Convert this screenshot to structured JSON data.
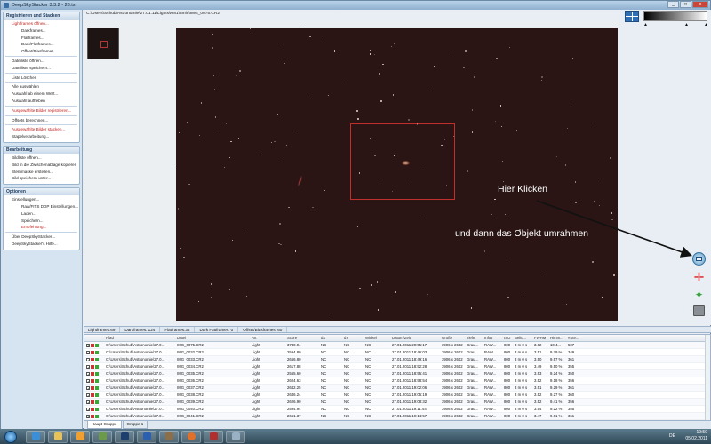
{
  "window": {
    "title": "DeepSkyStacker 3.3.2 - 28.txt",
    "buttons": [
      "_",
      "□",
      "x"
    ]
  },
  "path": "C:\\Users\\Schub\\Astronomie\\27.01.11\\Lights\\M81\\3min\\IMG_0075.CR2",
  "sidebar": {
    "group1": {
      "title": "Registrieren und Stacken",
      "items": [
        {
          "label": "Lightframes öffnen...",
          "red": true,
          "sub": false
        },
        {
          "label": "Darkframes...",
          "red": false,
          "sub": true
        },
        {
          "label": "Flatframes...",
          "red": false,
          "sub": true
        },
        {
          "label": "Dark/Flatframes...",
          "red": false,
          "sub": true
        },
        {
          "label": "Offset/Biasframes...",
          "red": false,
          "sub": true
        },
        {
          "label": "Dateiliste öffnen...",
          "red": false,
          "sub": false
        },
        {
          "label": "Dateiliste speichern...",
          "red": false,
          "sub": false
        },
        {
          "label": "Liste Löschen",
          "red": false,
          "sub": false
        },
        {
          "label": "Alle auswählen",
          "red": false,
          "sub": false
        },
        {
          "label": "Auswahl ab einem Wert...",
          "red": false,
          "sub": false
        },
        {
          "label": "Auswahl aufheben",
          "red": false,
          "sub": false
        },
        {
          "label": "Ausgewählte Bilder registrieren...",
          "red": true,
          "sub": false
        },
        {
          "label": "Offsets berechnen...",
          "red": false,
          "sub": false
        },
        {
          "label": "Ausgewählte Bilder stacken...",
          "red": true,
          "sub": false
        },
        {
          "label": "Stapelverarbeitung...",
          "red": false,
          "sub": false
        }
      ]
    },
    "group2": {
      "title": "Bearbeitung",
      "items": [
        "Bildliste öffnen...",
        "Bild in die Zwischenablage kopieren",
        "Sternmaske erstellen...",
        "Bild speichern unter..."
      ]
    },
    "group3": {
      "title": "Optionen",
      "items": [
        {
          "label": "Einstellungen...",
          "red": false,
          "sub": false
        },
        {
          "label": "Raw/FITS DDP Einstellungen...",
          "red": false,
          "sub": true
        },
        {
          "label": "Laden...",
          "red": false,
          "sub": true
        },
        {
          "label": "Speichern...",
          "red": false,
          "sub": true
        },
        {
          "label": "Empfehlung...",
          "red": true,
          "sub": true
        },
        {
          "label": "Über DeepSkyStacker...",
          "red": false,
          "sub": false
        },
        {
          "label": "DeepSkyStacker's Hilfe...",
          "red": false,
          "sub": false
        }
      ]
    }
  },
  "annotation": {
    "click_here": "Hier Klicken",
    "frame_object": "und dann das Objekt umrahmen"
  },
  "counts": [
    "Lightframes:69",
    "Darkframes: 124",
    "Flatframes:36",
    "Dark Flatframes: 0",
    "Offset/Biasframes: 60"
  ],
  "table": {
    "headers": [
      "",
      "Pfad",
      "Datei",
      "Art",
      "Score",
      "dX",
      "dY",
      "Winkel",
      "Datum/Zeit",
      "Größe",
      "Tiefe",
      "Infos",
      "ISO",
      "Belic...",
      "FWHM",
      "Himm...",
      "#Ste..."
    ],
    "rows": [
      [
        "C:\\Users\\Schub\\Astronomie\\27.0...",
        "IMG_0075.CR2",
        "Light",
        "3740.04",
        "NC",
        "NC",
        "NC",
        "27.01.2011 20:55:17",
        "3906 x 2602",
        "Grau...",
        "RAW...",
        "800",
        "3 m 0 s",
        "3.62",
        "10.4...",
        "507"
      ],
      [
        "C:\\Users\\Schub\\Astronomie\\27.0...",
        "IMG_0032.CR2",
        "Light",
        "2594.80",
        "NC",
        "NC",
        "NC",
        "27.01.2011 18:46:03",
        "3906 x 2602",
        "Grau...",
        "RAW...",
        "800",
        "3 m 0 s",
        "3.51",
        "9.79 %",
        "349"
      ],
      [
        "C:\\Users\\Schub\\Astronomie\\27.0...",
        "IMG_0033.CR2",
        "Light",
        "2666.80",
        "NC",
        "NC",
        "NC",
        "27.01.2011 18:49:16",
        "3906 x 2602",
        "Grau...",
        "RAW...",
        "800",
        "3 m 0 s",
        "3.50",
        "9.57 %",
        "361"
      ],
      [
        "C:\\Users\\Schub\\Astronomie\\27.0...",
        "IMG_0034.CR2",
        "Light",
        "2617.88",
        "NC",
        "NC",
        "NC",
        "27.01.2011 18:52:28",
        "3906 x 2602",
        "Grau...",
        "RAW...",
        "800",
        "3 m 0 s",
        "3.49",
        "9.50 %",
        "355"
      ],
      [
        "C:\\Users\\Schub\\Astronomie\\27.0...",
        "IMG_0035.CR2",
        "Light",
        "2565.60",
        "NC",
        "NC",
        "NC",
        "27.01.2011 18:55:41",
        "3906 x 2602",
        "Grau...",
        "RAW...",
        "800",
        "3 m 0 s",
        "3.53",
        "9.24 %",
        "350"
      ],
      [
        "C:\\Users\\Schub\\Astronomie\\27.0...",
        "IMG_0036.CR2",
        "Light",
        "2604.63",
        "NC",
        "NC",
        "NC",
        "27.01.2011 18:58:54",
        "3906 x 2602",
        "Grau...",
        "RAW...",
        "800",
        "3 m 0 s",
        "3.52",
        "9.18 %",
        "356"
      ],
      [
        "C:\\Users\\Schub\\Astronomie\\27.0...",
        "IMG_0037.CR2",
        "Light",
        "2642.25",
        "NC",
        "NC",
        "NC",
        "27.01.2011 19:02:06",
        "3906 x 2602",
        "Grau...",
        "RAW...",
        "800",
        "3 m 0 s",
        "3.51",
        "9.29 %",
        "361"
      ],
      [
        "C:\\Users\\Schub\\Astronomie\\27.0...",
        "IMG_0038.CR2",
        "Light",
        "2646.24",
        "NC",
        "NC",
        "NC",
        "27.01.2011 19:05:19",
        "3906 x 2602",
        "Grau...",
        "RAW...",
        "800",
        "3 m 0 s",
        "3.52",
        "9.27 %",
        "360"
      ],
      [
        "C:\\Users\\Schub\\Astronomie\\27.0...",
        "IMG_0039.CR2",
        "Light",
        "2626.90",
        "NC",
        "NC",
        "NC",
        "27.01.2011 19:08:32",
        "3906 x 2602",
        "Grau...",
        "RAW...",
        "800",
        "3 m 0 s",
        "3.52",
        "9.41 %",
        "356"
      ],
      [
        "C:\\Users\\Schub\\Astronomie\\27.0...",
        "IMG_0040.CR2",
        "Light",
        "2594.94",
        "NC",
        "NC",
        "NC",
        "27.01.2011 19:11:44",
        "3906 x 2602",
        "Grau...",
        "RAW...",
        "800",
        "3 m 0 s",
        "3.54",
        "9.22 %",
        "355"
      ],
      [
        "C:\\Users\\Schub\\Astronomie\\27.0...",
        "IMG_0041.CR2",
        "Light",
        "2661.37",
        "NC",
        "NC",
        "NC",
        "27.01.2011 19:14:57",
        "3906 x 2602",
        "Grau...",
        "RAW...",
        "800",
        "3 m 0 s",
        "3.47",
        "9.01 %",
        "361"
      ]
    ]
  },
  "bottom_tabs": [
    "Haupt-Gruppe",
    "Gruppe 1"
  ],
  "taskbar": {
    "lang": "DE",
    "time": "19:50",
    "date": "05.02.2011"
  },
  "colors": {
    "accent": "#3a6ea5",
    "menu_red": "#c0231f",
    "selection": "#c0302c"
  }
}
